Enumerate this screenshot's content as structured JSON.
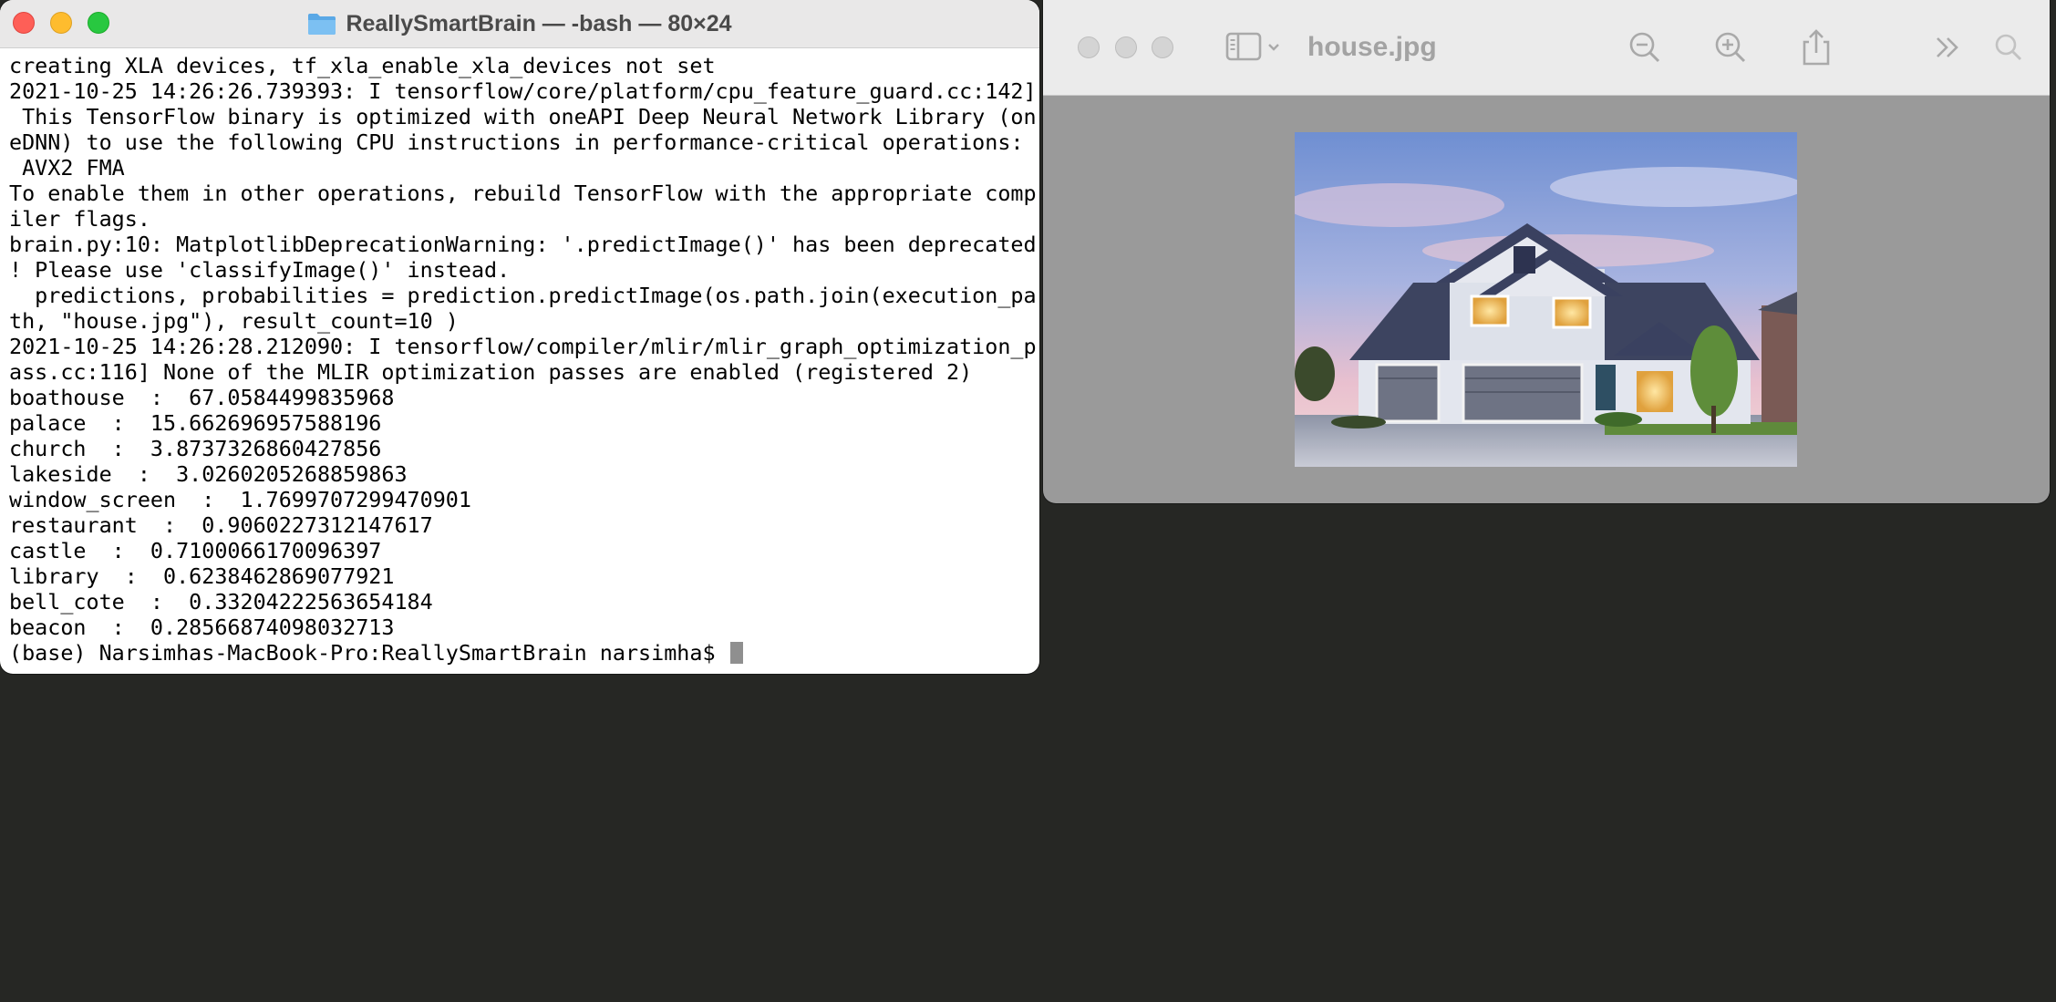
{
  "terminal": {
    "title": "ReallySmartBrain — -bash — 80×24",
    "lines": [
      "creating XLA devices, tf_xla_enable_xla_devices not set",
      "2021-10-25 14:26:26.739393: I tensorflow/core/platform/cpu_feature_guard.cc:142]",
      " This TensorFlow binary is optimized with oneAPI Deep Neural Network Library (on",
      "eDNN) to use the following CPU instructions in performance-critical operations:",
      " AVX2 FMA",
      "To enable them in other operations, rebuild TensorFlow with the appropriate comp",
      "iler flags.",
      "brain.py:10: MatplotlibDeprecationWarning: '.predictImage()' has been deprecated",
      "! Please use 'classifyImage()' instead.",
      "  predictions, probabilities = prediction.predictImage(os.path.join(execution_pa",
      "th, \"house.jpg\"), result_count=10 )",
      "2021-10-25 14:26:28.212090: I tensorflow/compiler/mlir/mlir_graph_optimization_p",
      "ass.cc:116] None of the MLIR optimization passes are enabled (registered 2)",
      "boathouse  :  67.0584499835968",
      "palace  :  15.662696957588196",
      "church  :  3.8737326860427856",
      "lakeside  :  3.0260205268859863",
      "window_screen  :  1.7699707299470901",
      "restaurant  :  0.9060227312147617",
      "castle  :  0.7100066170096397",
      "library  :  0.6238462869077921",
      "bell_cote  :  0.33204222563654184",
      "beacon  :  0.28566874098032713"
    ],
    "prompt": "(base) Narsimhas-MacBook-Pro:ReallySmartBrain narsimha$ "
  },
  "preview": {
    "title": "house.jpg",
    "icons": {
      "sidebar": "sidebar-icon",
      "zoom_out": "zoom-out-icon",
      "zoom_in": "zoom-in-icon",
      "share": "share-icon",
      "more": "chevron-double-right-icon",
      "search": "search-icon"
    }
  },
  "colors": {
    "desktop": "#262724",
    "close": "#fe5f57",
    "minimize": "#febc2e",
    "maximize": "#28c840"
  }
}
